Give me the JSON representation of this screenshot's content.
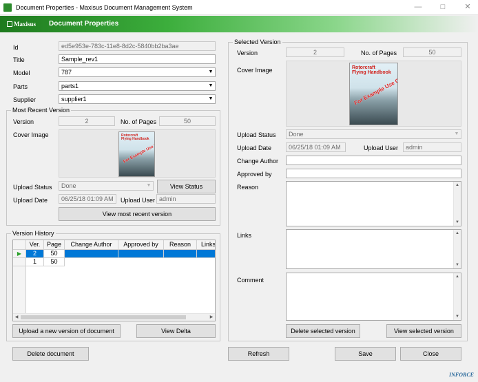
{
  "window": {
    "title": "Document Properties - Maxisus Document Management System",
    "min": "—",
    "max": "□",
    "close": "✕"
  },
  "banner": {
    "logo": "Maxisus",
    "title": "Document Properties"
  },
  "form": {
    "id_label": "Id",
    "id_value": "ed5e953e-783c-11e8-8d2c-5840bb2ba3ae",
    "title_label": "Title",
    "title_value": "Sample_rev1",
    "model_label": "Model",
    "model_value": "787",
    "parts_label": "Parts",
    "parts_value": "parts1",
    "supplier_label": "Supplier",
    "supplier_value": "supplier1"
  },
  "recent": {
    "group_title": "Most Recent Version",
    "version_label": "Version",
    "version_value": "2",
    "pages_label": "No. of Pages",
    "pages_value": "50",
    "cover_label": "Cover Image",
    "upload_status_label": "Upload Status",
    "upload_status_value": "Done",
    "view_status_button": "View Status",
    "upload_date_label": "Upload Date",
    "upload_date_value": "06/25/18 01:09 AM",
    "upload_user_label": "Upload User",
    "upload_user_value": "admin",
    "view_recent_button": "View most recent version"
  },
  "cover": {
    "title_line1": "Rotorcraft",
    "title_line2": "Flying Handbook",
    "stamp": "For Example Use Only"
  },
  "history": {
    "group_title": "Version History",
    "columns": [
      "Ver.",
      "Page",
      "Change Author",
      "Approved by",
      "Reason",
      "Links"
    ],
    "rows": [
      {
        "ver": "2",
        "page": "50",
        "author": "",
        "approved": "",
        "reason": "",
        "links": "",
        "selected": true
      },
      {
        "ver": "1",
        "page": "50",
        "author": "",
        "approved": "",
        "reason": "",
        "links": "",
        "selected": false
      }
    ],
    "upload_button": "Upload a new version of document",
    "view_delta_button": "View Delta"
  },
  "selected": {
    "group_title": "Selected Version",
    "version_label": "Version",
    "version_value": "2",
    "pages_label": "No. of Pages",
    "pages_value": "50",
    "cover_label": "Cover Image",
    "upload_status_label": "Upload Status",
    "upload_status_value": "Done",
    "upload_date_label": "Upload Date",
    "upload_date_value": "06/25/18 01:09 AM",
    "upload_user_label": "Upload User",
    "upload_user_value": "admin",
    "change_author_label": "Change Author",
    "change_author_value": "",
    "approved_by_label": "Approved by",
    "approved_by_value": "",
    "reason_label": "Reason",
    "links_label": "Links",
    "comment_label": "Comment",
    "delete_button": "Delete selected version",
    "view_button": "View selected version"
  },
  "footer": {
    "delete_document": "Delete document",
    "refresh": "Refresh",
    "save": "Save",
    "close": "Close",
    "brand": "INFORCE"
  },
  "colors": {
    "banner_green": "#2e8b2e",
    "selection_blue": "#0078d7",
    "stamp_red": "#d22222"
  }
}
